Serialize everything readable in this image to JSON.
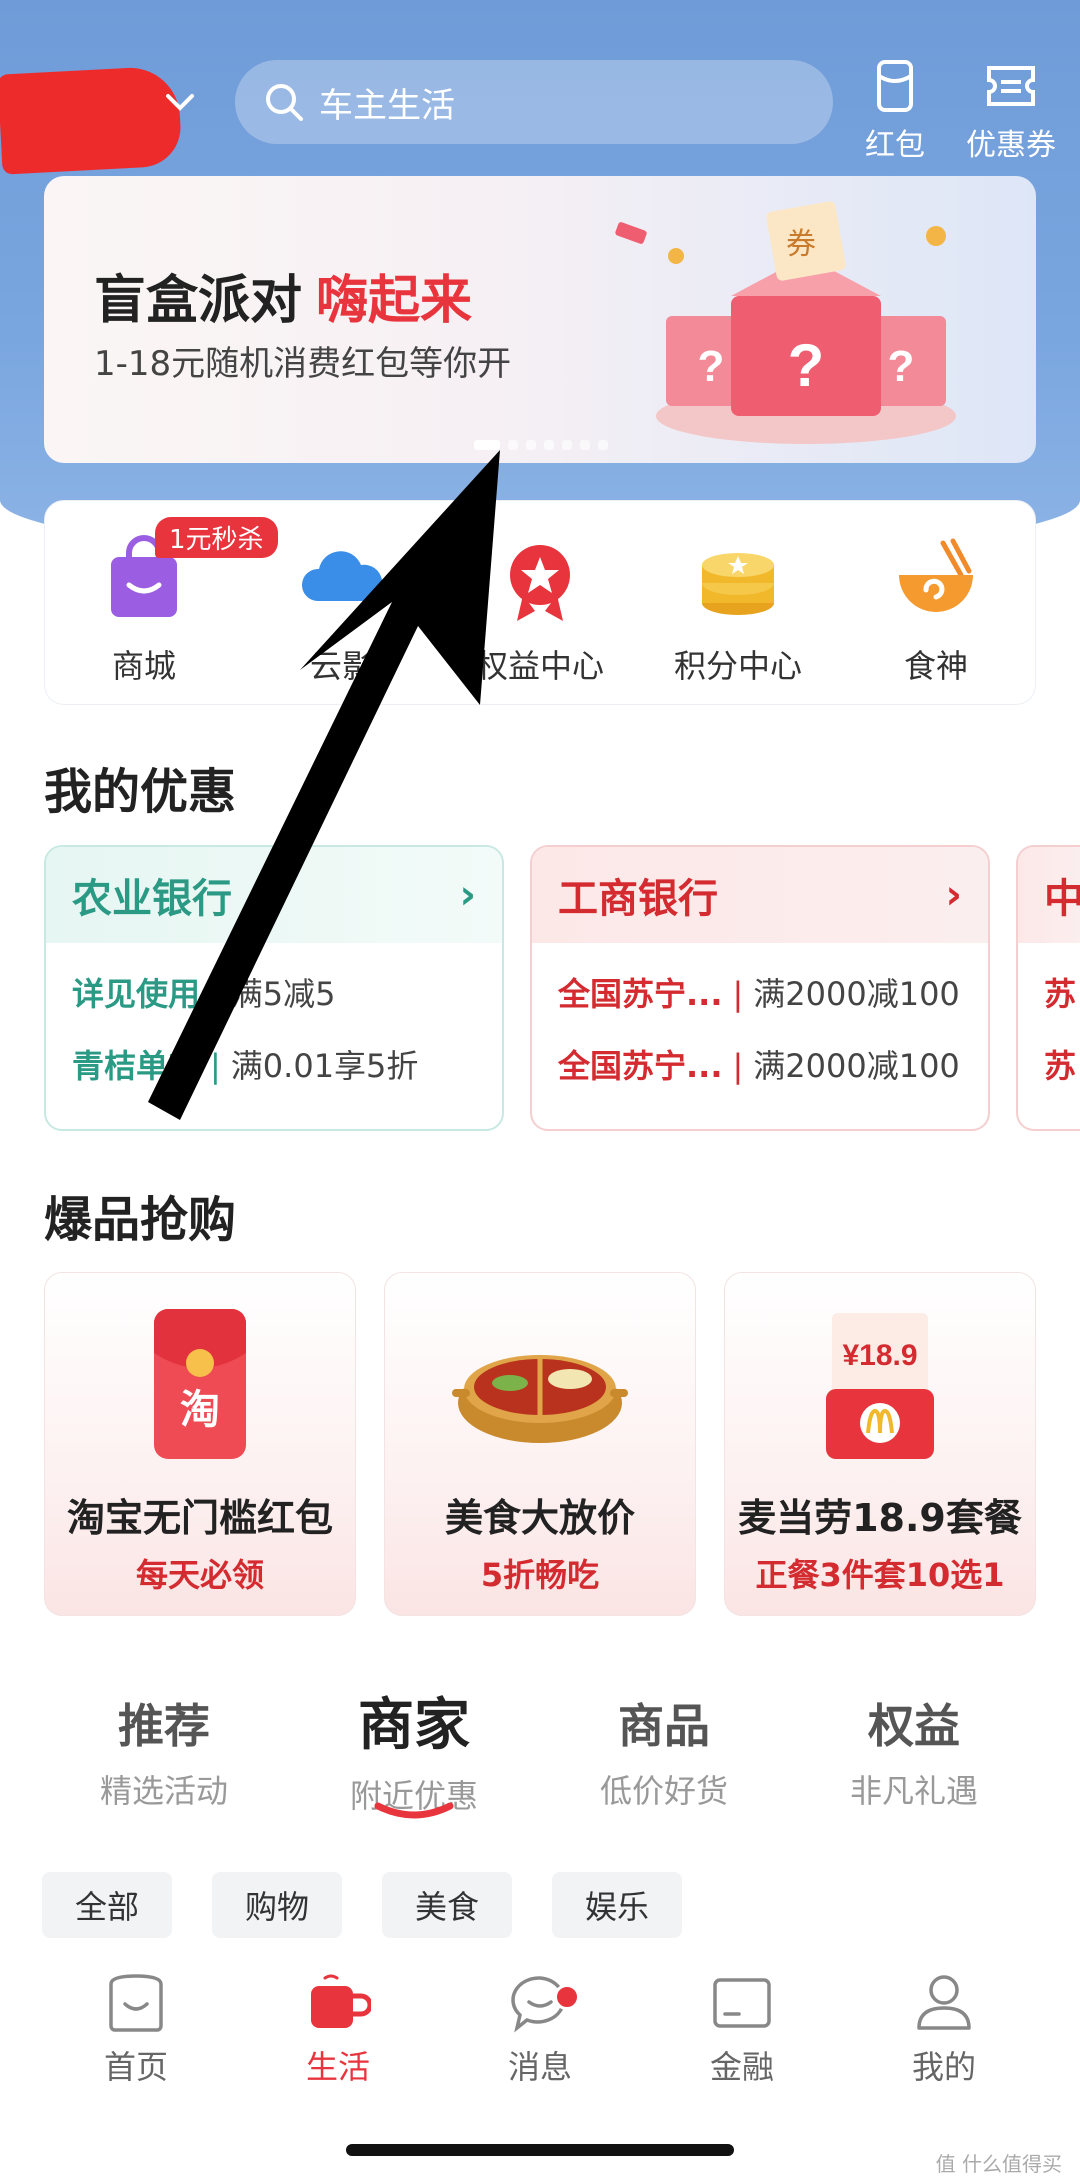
{
  "header": {
    "search_placeholder": "车主生活",
    "red_packet_label": "红包",
    "coupon_label": "优惠券"
  },
  "banner": {
    "title": "盲盒派对",
    "title_highlight": "嗨起来",
    "subtitle": "1-18元随机消费红包等你开",
    "art_text": "券"
  },
  "quick_entries": {
    "sale_tag": "1元秒杀",
    "items": [
      {
        "label": "商城"
      },
      {
        "label": "云影"
      },
      {
        "label": "权益中心"
      },
      {
        "label": "积分中心"
      },
      {
        "label": "食神"
      }
    ]
  },
  "my_offers": {
    "title": "我的优惠",
    "coupons": [
      {
        "bank": "农业银行",
        "rows": [
          {
            "merchant": "详见使用",
            "offer": "满5减5"
          },
          {
            "merchant": "青桔单车",
            "offer": "满0.01享5折"
          }
        ]
      },
      {
        "bank": "工商银行",
        "rows": [
          {
            "merchant": "全国苏宁...",
            "offer": "满2000减100"
          },
          {
            "merchant": "全国苏宁...",
            "offer": "满2000减100"
          }
        ]
      },
      {
        "bank": "中",
        "rows": [
          {
            "merchant": "苏",
            "offer": ""
          },
          {
            "merchant": "苏",
            "offer": ""
          }
        ]
      }
    ]
  },
  "hot_products": {
    "title": "爆品抢购",
    "items": [
      {
        "name": "淘宝无门槛红包",
        "sub": "每天必领",
        "icon_text": "淘"
      },
      {
        "name": "美食大放价",
        "sub": "5折畅吃"
      },
      {
        "name": "麦当劳18.9套餐",
        "sub": "正餐3件套10选1",
        "price_text": "¥18.9"
      }
    ]
  },
  "tabs": [
    {
      "title": "推荐",
      "sub": "精选活动"
    },
    {
      "title": "商家",
      "sub": "附近优惠"
    },
    {
      "title": "商品",
      "sub": "低价好货"
    },
    {
      "title": "权益",
      "sub": "非凡礼遇"
    }
  ],
  "active_tab": "商家",
  "filters": [
    "全部",
    "购物",
    "美食",
    "娱乐"
  ],
  "bottom_nav": [
    {
      "label": "首页"
    },
    {
      "label": "生活"
    },
    {
      "label": "消息"
    },
    {
      "label": "金融"
    },
    {
      "label": "我的"
    }
  ],
  "active_nav": "生活",
  "watermark": "值 什么值得买",
  "colors": {
    "accent_red": "#e8343c",
    "header_blue": "#7aa6df",
    "green": "#2b9a85"
  }
}
